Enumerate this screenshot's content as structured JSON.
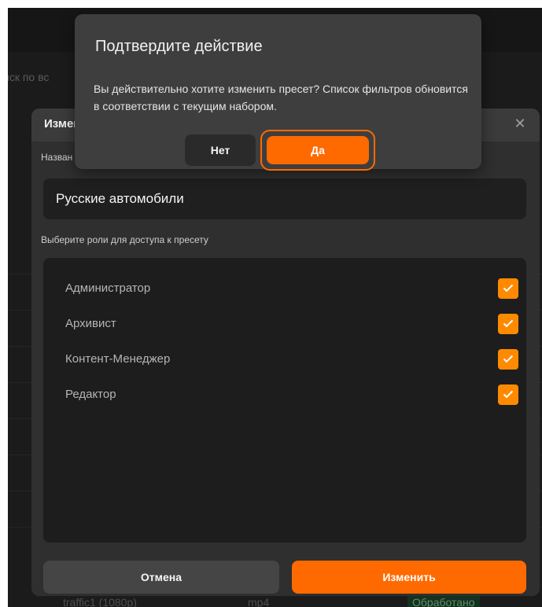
{
  "background": {
    "search_placeholder": "иск по вс",
    "footer_row": {
      "file": "traffic1 (1080p)",
      "format": "mp4",
      "status": "Обработано"
    }
  },
  "edit_modal": {
    "title": "Измен",
    "name_label": "Назван",
    "name_value": "Русские автомобили",
    "roles_label": "Выберите роли для доступа к пресету",
    "roles": [
      {
        "label": "Администратор",
        "checked": true
      },
      {
        "label": "Архивист",
        "checked": true
      },
      {
        "label": "Контент-Менеджер",
        "checked": true
      },
      {
        "label": "Редактор",
        "checked": true
      }
    ],
    "cancel_label": "Отмена",
    "apply_label": "Изменить"
  },
  "confirm_dialog": {
    "title": "Подтвердите действие",
    "message": "Вы действительно хотите изменить пресет? Список фильтров обновится в соответствии с текущим набором.",
    "no_label": "Нет",
    "yes_label": "Да"
  },
  "colors": {
    "accent": "#ff6a00",
    "checkbox": "#ff8a00",
    "dialog_bg": "#3e3e3e"
  }
}
